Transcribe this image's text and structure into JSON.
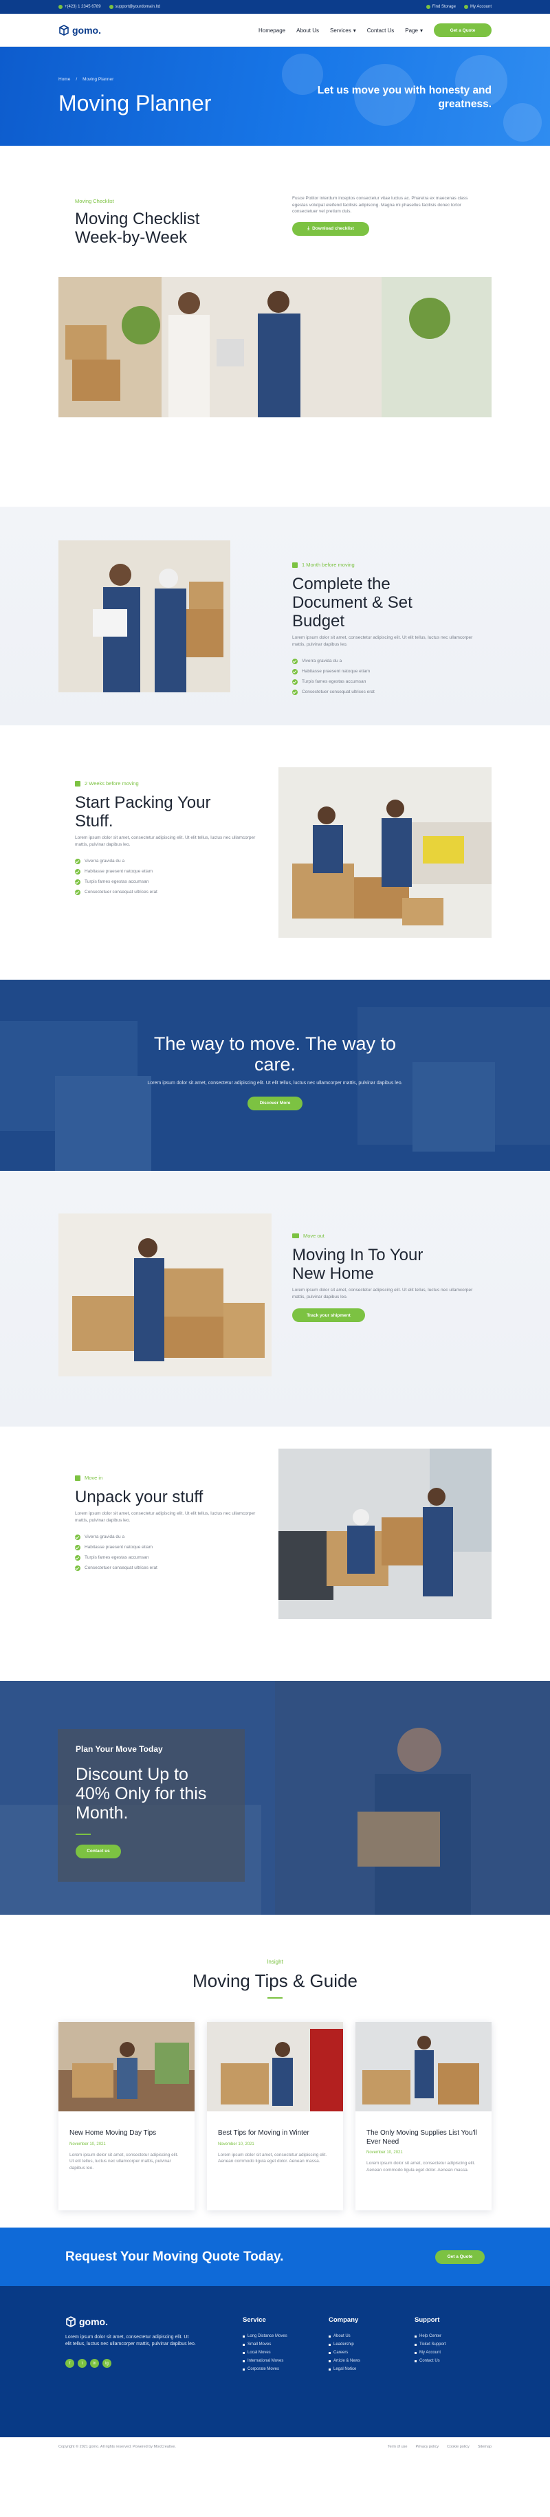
{
  "topbar": {
    "phone": "+(423) 1 2345 6789",
    "email": "support@yourdomain.ltd",
    "find_storage": "Find Storage",
    "my_account": "My Account"
  },
  "nav": {
    "logo": "gomo.",
    "items": [
      "Homepage",
      "About Us",
      "Services",
      "Contact Us",
      "Page"
    ],
    "cta": "Get a Quote"
  },
  "hero": {
    "crumb_home": "Home",
    "crumb_sep": "/",
    "crumb_current": "Moving Planner",
    "title": "Moving Planner",
    "tagline": "Let us move you with honesty and greatness."
  },
  "intro": {
    "eyebrow": "Moving Checklist",
    "title": "Moving Checklist Week-by-Week",
    "text": "Fusce Potitor interdum inceptos consectetur vitae luctus ac. Pharetra ex maecenas class egestas volutpat eleifend facilisis adipiscing. Magna mi phasellus facilisis donec tortor consectetuer vel pretium duis.",
    "button": "Download checklist"
  },
  "sections": [
    {
      "eyebrow": "1 Month before moving",
      "title": "Complete the Document & Set Budget",
      "text": "Lorem ipsum dolor sit amet, consectetur adipiscing elit. Ut elit tellus, luctus nec ullamcorper mattis, pulvinar dapibus leo.",
      "list": [
        "Viverra gravida du a",
        "Habitasse praesent natoque etiam",
        "Turpis fames egestas accumsan",
        "Consectetuer consequat ultrices erat"
      ]
    },
    {
      "eyebrow": "2 Weeks before moving",
      "title": "Start Packing Your Stuff.",
      "text": "Lorem ipsum dolor sit amet, consectetur adipiscing elit. Ut elit tellus, luctus nec ullamcorper mattis, pulvinar dapibus leo.",
      "list": [
        "Viverra gravida du a",
        "Habitasse praesent natoque etiam",
        "Turpis fames egestas accumsan",
        "Consectetuer consequat ultrices erat"
      ]
    },
    {
      "eyebrow": "Move out",
      "title": "Moving In To Your New Home",
      "text": "Lorem ipsum dolor sit amet, consectetur adipiscing elit. Ut elit tellus, luctus nec ullamcorper mattis, pulvinar dapibus leo.",
      "button": "Track your shipment"
    },
    {
      "eyebrow": "Move in",
      "title": "Unpack your stuff",
      "text": "Lorem ipsum dolor sit amet, consectetur adipiscing elit. Ut elit tellus, luctus nec ullamcorper mattis, pulvinar dapibus leo.",
      "list": [
        "Viverra gravida du a",
        "Habitasse praesent natoque etiam",
        "Turpis fames egestas accumsan",
        "Consectetuer consequat ultrices erat"
      ]
    }
  ],
  "quote_band": {
    "title": "The way to move. The way to care.",
    "text": "Lorem ipsum dolor sit amet, consectetur adipiscing elit. Ut elit tellus, luctus nec ullamcorper mattis, pulvinar dapibus leo.",
    "button": "Discover More"
  },
  "promo": {
    "kicker": "Plan Your Move Today",
    "title": "Discount Up to 40% Only for this Month.",
    "button": "Contact us"
  },
  "blog": {
    "kicker": "Insight",
    "title": "Moving Tips & Guide",
    "posts": [
      {
        "title": "New Home Moving Day Tips",
        "date": "November 10, 2021",
        "excerpt": "Lorem ipsum dolor sit amet, consectetur adipiscing elit. Ut elit tellus, luctus nec ullamcorper mattis, pulvinar dapibus leo."
      },
      {
        "title": "Best Tips for Moving in Winter",
        "date": "November 10, 2021",
        "excerpt": "Lorem ipsum dolor sit amet, consectetur adipiscing elit. Aenean commodo ligula eget dolor. Aenean massa."
      },
      {
        "title": "The Only Moving Supplies List You'll Ever Need",
        "date": "November 10, 2021",
        "excerpt": "Lorem ipsum dolor sit amet, consectetur adipiscing elit. Aenean commodo ligula eget dolor. Aenean massa."
      }
    ]
  },
  "cta": {
    "title": "Request Your Moving Quote Today.",
    "button": "Get a Quote"
  },
  "footer": {
    "logo": "gomo.",
    "about": "Lorem ipsum dolor sit amet, consectetur adipiscing elit. Ut elit tellus, luctus nec ullamcorper mattis, pulvinar dapibus leo.",
    "social": [
      "f",
      "t",
      "in",
      "ig"
    ],
    "columns": [
      {
        "title": "Service",
        "links": [
          "Long Distance Moves",
          "Small Moves",
          "Local Moves",
          "International Moves",
          "Corporate Moves"
        ]
      },
      {
        "title": "Company",
        "links": [
          "About Us",
          "Leadership",
          "Careers",
          "Article & News",
          "Legal Notice"
        ]
      },
      {
        "title": "Support",
        "links": [
          "Help Center",
          "Ticket Support",
          "My Account",
          "Contact Us"
        ]
      }
    ],
    "copyright": "Copyright © 2021 gomo. All rights reserved. Powered by MoxCreative.",
    "legal": [
      "Term of use",
      "Privacy policy",
      "Cookie policy",
      "Sitemap"
    ]
  },
  "colors": {
    "brand_blue": "#0c3d8c",
    "accent_green": "#7cc242",
    "hero_blue": "#1877e8"
  }
}
